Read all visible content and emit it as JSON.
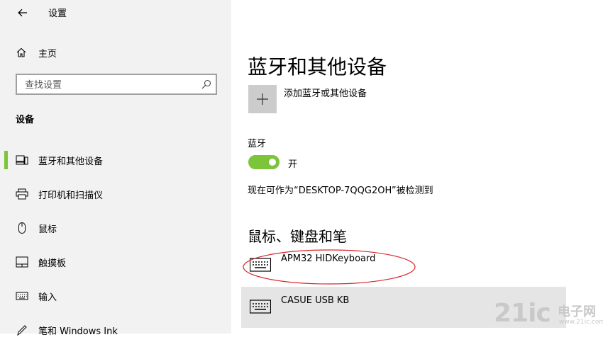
{
  "window": {
    "title": "设置"
  },
  "sidebar": {
    "home_label": "主页",
    "search": {
      "placeholder": "查找设置",
      "value": ""
    },
    "section_header": "设备",
    "items": [
      {
        "label": "蓝牙和其他设备",
        "icon": "bluetooth-devices-icon",
        "selected": true
      },
      {
        "label": "打印机和扫描仪",
        "icon": "printer-icon",
        "selected": false
      },
      {
        "label": "鼠标",
        "icon": "mouse-icon",
        "selected": false
      },
      {
        "label": "触摸板",
        "icon": "touchpad-icon",
        "selected": false
      },
      {
        "label": "输入",
        "icon": "keyboard-icon",
        "selected": false
      },
      {
        "label": "笔和 Windows Ink",
        "icon": "pen-icon",
        "selected": false
      }
    ]
  },
  "main": {
    "page_title": "蓝牙和其他设备",
    "add_device_label": "添加蓝牙或其他设备",
    "bluetooth": {
      "heading": "蓝牙",
      "toggle_on": true,
      "state_label": "开",
      "discoverable_text": "现在可作为“DESKTOP-7QQG2OH”被检测到"
    },
    "input_devices": {
      "heading": "鼠标、键盘和笔",
      "devices": [
        {
          "name": "APM32 HIDKeyboard",
          "icon": "keyboard-icon",
          "selected": false
        },
        {
          "name": "CASUE USB KB",
          "icon": "keyboard-icon",
          "selected": true
        }
      ]
    }
  },
  "annotation": {
    "color": "#d9262a",
    "shape": "ellipse"
  },
  "watermark": {
    "number": "21ic",
    "cn": "电子网",
    "url": "www.21ic.com"
  },
  "colors": {
    "accent": "#7cc43a",
    "sidebar_bg": "#f2f2f2",
    "selected_row": "#e5e5e5",
    "tile": "#cccccc"
  }
}
